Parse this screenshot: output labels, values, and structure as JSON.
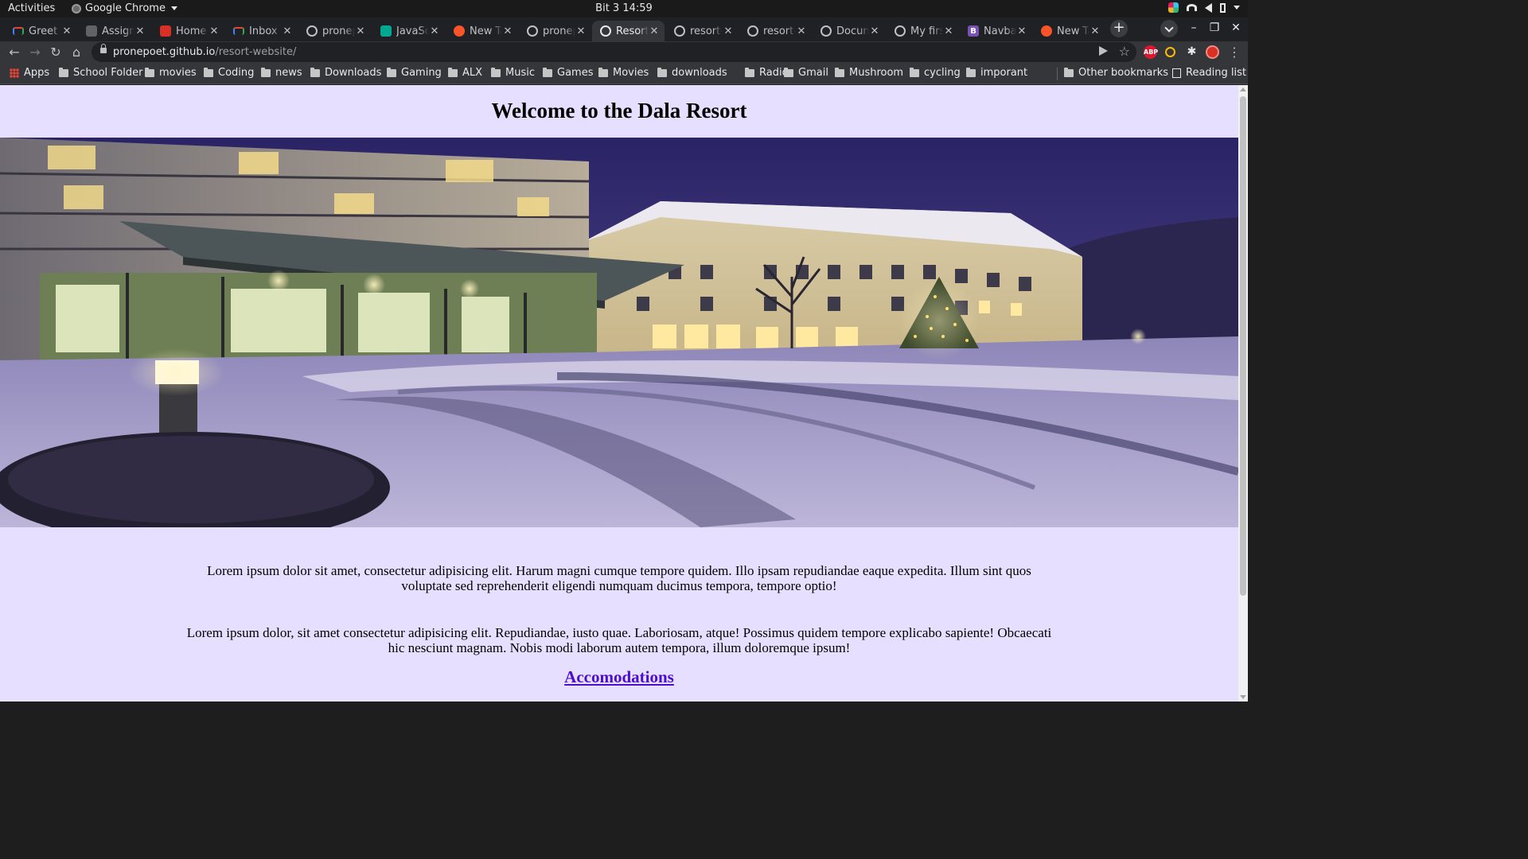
{
  "system_bar": {
    "activities": "Activities",
    "app_name": "Google Chrome",
    "clock": "Bit 3  14:59"
  },
  "tabs": [
    {
      "title": "Greet y",
      "favicon": "gmail-icon",
      "color": "#ea4335",
      "active": false
    },
    {
      "title": "Assign",
      "favicon": "page-icon",
      "color": "#5f6368",
      "active": false
    },
    {
      "title": "Home |",
      "favicon": "square-icon",
      "color": "#d93025",
      "active": false
    },
    {
      "title": "Inbox (",
      "favicon": "gmail-icon",
      "color": "#ea4335",
      "active": false
    },
    {
      "title": "pronep",
      "favicon": "github-icon",
      "color": "#bdc1c6",
      "active": false
    },
    {
      "title": "JavaSc",
      "favicon": "leaf-icon",
      "color": "#00a98f",
      "active": false
    },
    {
      "title": "New Ta",
      "favicon": "brave-icon",
      "color": "#fb542b",
      "active": false
    },
    {
      "title": "pronep",
      "favicon": "github-icon",
      "color": "#bdc1c6",
      "active": false
    },
    {
      "title": "Resort",
      "favicon": "globe-icon",
      "color": "#e8eaed",
      "active": true
    },
    {
      "title": "resort-",
      "favicon": "globe-icon",
      "color": "#bdc1c6",
      "active": false
    },
    {
      "title": "resort-",
      "favicon": "globe-icon",
      "color": "#bdc1c6",
      "active": false
    },
    {
      "title": "Docun",
      "favicon": "globe-icon",
      "color": "#bdc1c6",
      "active": false
    },
    {
      "title": "My firs",
      "favicon": "globe-icon",
      "color": "#bdc1c6",
      "active": false
    },
    {
      "title": "Navba",
      "favicon": "bootstrap-icon",
      "color": "#7952b3",
      "active": false
    },
    {
      "title": "New Ta",
      "favicon": "brave-icon",
      "color": "#fb542b",
      "active": false
    }
  ],
  "address_bar": {
    "domain": "pronepoet.github.io",
    "path": "/resort-website/"
  },
  "extensions": [
    {
      "name": "adblock-icon",
      "label": "ABP",
      "color": "#d9192f"
    },
    {
      "name": "extension-icon",
      "label": "",
      "color": "#fbbc04"
    }
  ],
  "bookmarks": {
    "apps_label": "Apps",
    "items": [
      "School Folder",
      "movies",
      "Coding",
      "news",
      "Downloads",
      "Gaming",
      "ALX",
      "Music",
      "Games",
      "Movies",
      "downloads",
      "Radio",
      "Gmail",
      "Mushroom",
      "cycling",
      "imporant"
    ],
    "other": "Other bookmarks",
    "reading_list": "Reading list"
  },
  "page": {
    "title": "Welcome to the Dala Resort",
    "hero_alt": "Resort building at night in the snow",
    "paragraph1": "Lorem ipsum dolor sit amet, consectetur adipisicing elit. Harum magni cumque tempore quidem. Illo ipsam repudiandae eaque expedita. Illum sint quos voluptate sed reprehenderit eligendi numquam ducimus tempora, tempore optio!",
    "paragraph2": "Lorem ipsum dolor, sit amet consectetur adipisicing elit. Repudiandae, iusto quae. Laboriosam, atque! Possimus quidem tempore explicabo sapiente! Obcaecati hic nesciunt magnam. Nobis modi laborum autem tempora, illum doloremque ipsum!",
    "link_label": "Accomodations",
    "link_color": "#4b0ed0",
    "background": "#e6dfff"
  }
}
